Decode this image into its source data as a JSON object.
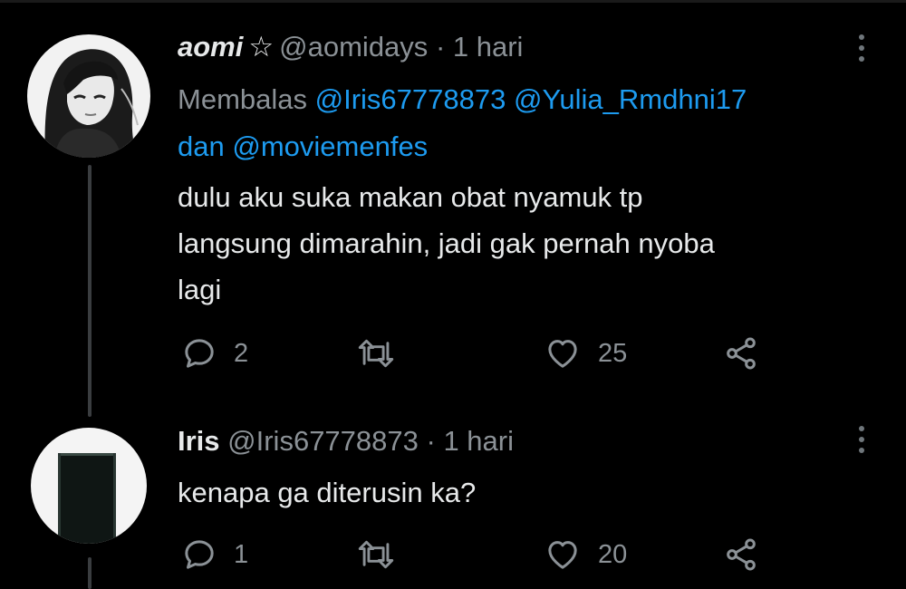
{
  "tweets": [
    {
      "display_name": "aomi",
      "badge": "☆",
      "handle": "@aomidays",
      "separator": "·",
      "time": "1 hari",
      "reply_prefix": "Membalas",
      "reply_mentions": [
        "@Iris67778873",
        "@Yulia_Rmdhni17"
      ],
      "reply_conjunction": "dan",
      "reply_last_mention": "@moviemenfes",
      "text_lines": [
        "dulu aku suka makan obat nyamuk tp",
        "langsung dimarahin, jadi gak pernah nyoba",
        "lagi"
      ],
      "reply_count": "2",
      "retweet_count": "",
      "like_count": "25",
      "avatar_icon": "anime-girl-avatar"
    },
    {
      "display_name": "Iris",
      "handle": "@Iris67778873",
      "separator": "·",
      "time": "1 hari",
      "text_lines": [
        "kenapa ga diterusin ka?"
      ],
      "reply_count": "1",
      "retweet_count": "",
      "like_count": "20",
      "avatar_icon": "doorway-avatar"
    }
  ],
  "colors": {
    "background": "#000000",
    "text": "#e7e9ea",
    "secondary": "#8b9196",
    "mention": "#1d9bf0"
  }
}
